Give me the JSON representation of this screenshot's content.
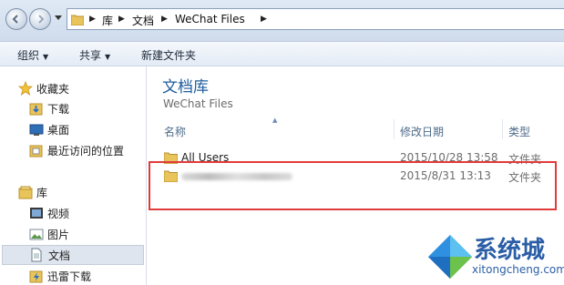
{
  "address": {
    "crumbs": [
      "库",
      "文档",
      "WeChat Files"
    ]
  },
  "toolbar": {
    "organize": "组织",
    "share": "共享",
    "new_folder": "新建文件夹"
  },
  "sidebar": {
    "favorites_label": "收藏夹",
    "favorites": [
      "下载",
      "桌面",
      "最近访问的位置"
    ],
    "libraries_label": "库",
    "libraries": [
      "视频",
      "图片",
      "文档",
      "迅雷下载"
    ],
    "selected": "文档"
  },
  "library": {
    "title": "文档库",
    "subtitle": "WeChat Files"
  },
  "columns": {
    "name": "名称",
    "date": "修改日期",
    "type": "类型"
  },
  "files": [
    {
      "name": "All Users",
      "date": "2015/10/28 13:58",
      "type": "文件夹"
    },
    {
      "name": "",
      "date": "2015/8/31 13:13",
      "type": "文件夹"
    }
  ],
  "watermark": {
    "brand": "系统城",
    "url": "xitongcheng.com"
  },
  "colors": {
    "highlight": "#e13b3b",
    "library_title": "#1c5c9e"
  }
}
